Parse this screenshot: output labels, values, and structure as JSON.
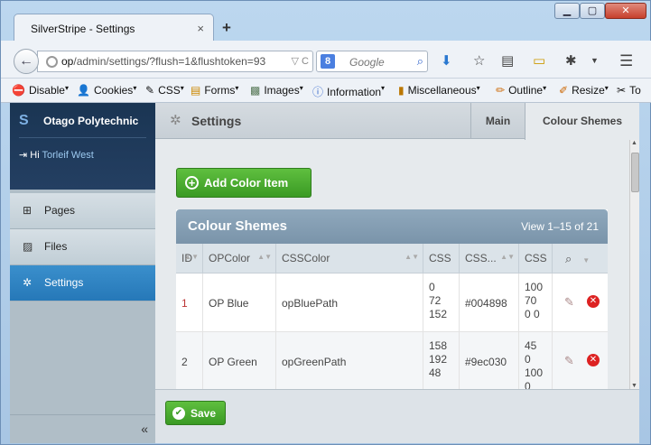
{
  "browser": {
    "tab_title": "SilverStripe - Settings",
    "tab_close": "×",
    "new_tab": "+",
    "window": {
      "minimize": "▁",
      "maximize": "▢",
      "close": "✕"
    },
    "url_domain": "op",
    "url_rest": "/admin/settings/?flush=1&flushtoken=93",
    "url_controls": "▽ C",
    "search_engine": "8",
    "search_placeholder": "Google"
  },
  "bookmarks": [
    {
      "label": "Disable",
      "icon": "⛔"
    },
    {
      "label": "Cookies",
      "icon": "👤"
    },
    {
      "label": "CSS",
      "icon": "✎"
    },
    {
      "label": "Forms",
      "icon": "▤"
    },
    {
      "label": "Images",
      "icon": "▩"
    },
    {
      "label": "Information",
      "icon": "ⓘ"
    },
    {
      "label": "Miscellaneous",
      "icon": "▮"
    },
    {
      "label": "Outline",
      "icon": "✏"
    },
    {
      "label": "Resize",
      "icon": "✐"
    },
    {
      "label": "To",
      "icon": "✂"
    }
  ],
  "sidebar": {
    "org_name": "Otago Polytechnic",
    "greeting": "Hi",
    "user": "Torleif West",
    "items": [
      {
        "label": "Pages",
        "icon": "pages-icon"
      },
      {
        "label": "Files",
        "icon": "files-icon"
      },
      {
        "label": "Settings",
        "icon": "settings-icon",
        "active": true
      }
    ],
    "collapse": "«"
  },
  "header": {
    "title": "Settings",
    "tabs": [
      {
        "label": "Main"
      },
      {
        "label": "Colour Shemes",
        "active": true
      }
    ]
  },
  "main": {
    "add_button": "Add Color Item",
    "grid_title": "Colour Shemes",
    "pagination": "View 1–15 of 21",
    "columns": [
      "ID",
      "OPColor",
      "CSSColor",
      "CSS",
      "CSS...",
      "CSS"
    ],
    "rows": [
      {
        "id": "1",
        "op_color": "OP Blue",
        "css_color": "opBluePath",
        "rgb": [
          "0",
          "72",
          "152"
        ],
        "hex": "#004898",
        "cmyk": [
          "100",
          "70",
          "0 0"
        ]
      },
      {
        "id": "2",
        "op_color": "OP Green",
        "css_color": "opGreenPath",
        "rgb": [
          "158",
          "192",
          "48"
        ],
        "hex": "#9ec030",
        "cmyk": [
          "45",
          "0",
          "100",
          "0"
        ]
      }
    ]
  },
  "footer": {
    "save_button": "Save"
  },
  "colors": {
    "accent_green": "#3a9a24",
    "sidebar_active": "#2678b8",
    "sidebar_dark": "#1a3553",
    "delete_red": "#dd2222"
  }
}
